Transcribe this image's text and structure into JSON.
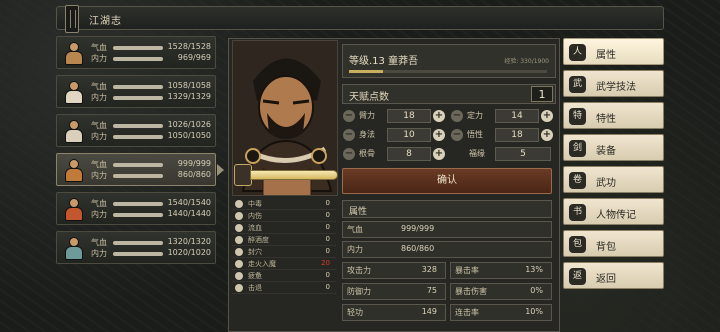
{
  "header": {
    "title": "江湖志"
  },
  "party": [
    {
      "hp_label": "气血",
      "mp_label": "内力",
      "hp": "1528/1528",
      "mp": "969/969",
      "hp_frac": 1.0,
      "mp_frac": 1.0,
      "tone": "#b8864f"
    },
    {
      "hp_label": "气血",
      "mp_label": "内力",
      "hp": "1058/1058",
      "mp": "1329/1329",
      "hp_frac": 1.0,
      "mp_frac": 1.0,
      "tone": "#e0d6c2"
    },
    {
      "hp_label": "气血",
      "mp_label": "内力",
      "hp": "1026/1026",
      "mp": "1050/1050",
      "hp_frac": 1.0,
      "mp_frac": 1.0,
      "tone": "#d9cfbb"
    },
    {
      "hp_label": "气血",
      "mp_label": "内力",
      "hp": "999/999",
      "mp": "860/860",
      "hp_frac": 1.0,
      "mp_frac": 1.0,
      "tone": "#c07a3a"
    },
    {
      "hp_label": "气血",
      "mp_label": "内力",
      "hp": "1540/1540",
      "mp": "1440/1440",
      "hp_frac": 1.0,
      "mp_frac": 1.0,
      "tone": "#c2562e"
    },
    {
      "hp_label": "气血",
      "mp_label": "内力",
      "hp": "1320/1320",
      "mp": "1020/1020",
      "hp_frac": 1.0,
      "mp_frac": 1.0,
      "tone": "#6e9a9a"
    }
  ],
  "character": {
    "name": "等级.13  童莽吾",
    "exp": "经验: 330/1900",
    "exp_frac": 0.17,
    "talent_label": "天赋点数",
    "talent_points": "1",
    "confirm": "确认"
  },
  "attributes": [
    {
      "name": "臂力",
      "value": "18"
    },
    {
      "name": "定力",
      "value": "14"
    },
    {
      "name": "身法",
      "value": "10"
    },
    {
      "name": "悟性",
      "value": "18"
    },
    {
      "name": "根骨",
      "value": "8"
    },
    {
      "name": "福缘",
      "value": "5"
    }
  ],
  "status": [
    {
      "name": "中毒",
      "value": "0",
      "hot": false
    },
    {
      "name": "内伤",
      "value": "0",
      "hot": false
    },
    {
      "name": "流血",
      "value": "0",
      "hot": false
    },
    {
      "name": "醉酒度",
      "value": "0",
      "hot": false
    },
    {
      "name": "封穴",
      "value": "0",
      "hot": false
    },
    {
      "name": "走火入魔",
      "value": "20",
      "hot": true
    },
    {
      "name": "疲惫",
      "value": "0",
      "hot": false
    },
    {
      "name": "击退",
      "value": "0",
      "hot": false
    }
  ],
  "attr_section": "属性",
  "stats": {
    "hp_label": "气血",
    "hp": "999/999",
    "mp_label": "内力",
    "mp": "860/860",
    "atk_label": "攻击力",
    "atk": "328",
    "crit_label": "暴击率",
    "crit": "13%",
    "def_label": "防御力",
    "def": "75",
    "critdmg_label": "暴击伤害",
    "critdmg": "0%",
    "qinggong_label": "轻功",
    "qinggong": "149",
    "combo_label": "连击率",
    "combo": "10%"
  },
  "menu": [
    {
      "label": "属性",
      "icon": "person-icon",
      "glyph": "人"
    },
    {
      "label": "武学技法",
      "icon": "martial-skill-icon",
      "glyph": "武"
    },
    {
      "label": "特性",
      "icon": "trait-icon",
      "glyph": "特"
    },
    {
      "label": "装备",
      "icon": "sword-icon",
      "glyph": "剑"
    },
    {
      "label": "武功",
      "icon": "scroll-icon",
      "glyph": "卷"
    },
    {
      "label": "人物传记",
      "icon": "book-icon",
      "glyph": "书"
    },
    {
      "label": "背包",
      "icon": "bag-icon",
      "glyph": "包"
    },
    {
      "label": "返回",
      "icon": "return-icon",
      "glyph": "返"
    }
  ]
}
